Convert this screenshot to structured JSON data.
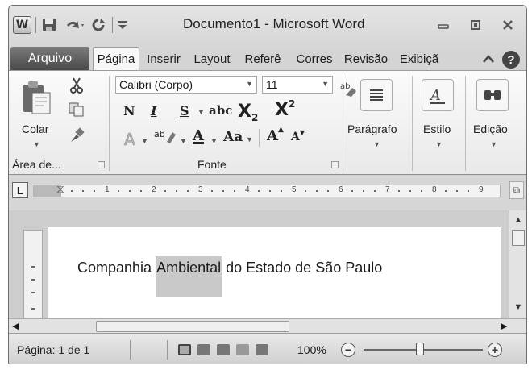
{
  "window": {
    "title": "Documento1  -  Microsoft Word",
    "app_icon_letter": "W",
    "controls": [
      "minimize-icon",
      "restore-icon",
      "close-icon"
    ]
  },
  "quick_access": [
    "save-icon",
    "undo-icon",
    "redo-icon",
    "customize-qat-icon"
  ],
  "tabs": {
    "file": "Arquivo",
    "items": [
      "Página",
      "Inserir",
      "Layout",
      "Referê",
      "Corres",
      "Revisão",
      "Exibiçã"
    ],
    "active": "Página"
  },
  "ribbon": {
    "clipboard": {
      "paste_label": "Colar",
      "group_label": "Área de..."
    },
    "font": {
      "font_name": "Calibri (Corpo)",
      "font_size": "11",
      "bold": "N",
      "italic": "I",
      "underline": "S",
      "strike": "abc",
      "subscript": "X",
      "subscript_mark": "2",
      "superscript": "X",
      "superscript_mark": "2",
      "highlight": "ab",
      "font_color": "A",
      "change_case": "Aa",
      "grow_font": "A",
      "shrink_font": "A",
      "group_label": "Fonte"
    },
    "paragraph_label": "Parágrafo",
    "styles_label": "Estilo",
    "editing_label": "Edição"
  },
  "ruler": {
    "tab_selector": "L",
    "numbers": [
      "1",
      "2",
      "3",
      "4",
      "5",
      "6",
      "7",
      "8",
      "9"
    ]
  },
  "document": {
    "before": "Companhia ",
    "highlighted": "Ambiental",
    "after": " do Estado de São Paulo"
  },
  "status_bar": {
    "page": "Página: 1 de 1",
    "zoom": "100%",
    "zoom_minus": "−",
    "zoom_plus": "+"
  }
}
